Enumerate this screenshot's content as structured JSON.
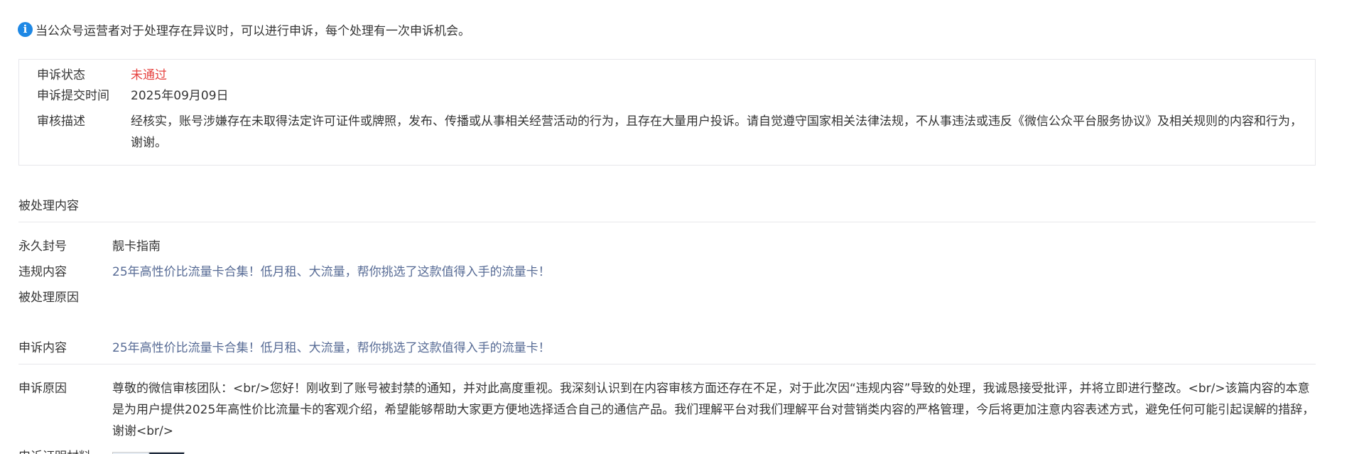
{
  "notice": {
    "icon": "info-icon",
    "text": "当公众号运营者对于处理存在异议时，可以进行申诉，每个处理有一次申诉机会。"
  },
  "status": {
    "state_label": "申诉状态",
    "state_value": "未通过",
    "state_color": "#e64340",
    "submit_label": "申诉提交时间",
    "submit_value": "2025年09月09日",
    "desc_label": "审核描述",
    "desc_value": "经核实，账号涉嫌存在未取得法定许可证件或牌照，发布、传播或从事相关经营活动的行为，且存在大量用户投诉。请自觉遵守国家相关法律法规，不从事违法或违反《微信公众平台服务协议》及相关规则的内容和行为，谢谢。"
  },
  "processed": {
    "section_title": "被处理内容",
    "ban_label": "永久封号",
    "ban_value": "靓卡指南",
    "violation_label": "违规内容",
    "violation_value": "25年高性价比流量卡合集！低月租、大流量，帮你挑选了这款值得入手的流量卡！",
    "reason_label": "被处理原因",
    "reason_value": ""
  },
  "appeal": {
    "content_label": "申诉内容",
    "content_value": "25年高性价比流量卡合集！低月租、大流量，帮你挑选了这款值得入手的流量卡！",
    "reason_label": "申诉原因",
    "reason_value": "尊敬的微信审核团队：<br/>您好！刚收到了账号被封禁的通知，并对此高度重视。我深刻认识到在内容审核方面还存在不足，对于此次因“违规内容”导致的处理，我诚恳接受批评，并将立即进行整改。<br/>该篇内容的本意是为用户提供2025年高性价比流量卡的客观介绍，希望能够帮助大家更方便地选择适合自己的通信产品。我们理解平台对我们理解平台对营销类内容的严格管理，今后将更加注意内容表述方式，避免任何可能引起误解的措辞，谢谢<br/>",
    "evidence_label": "申诉证明材料"
  },
  "colors": {
    "link": "#576b95",
    "text": "#353535",
    "border": "#e7e7eb",
    "info": "#1e88e5"
  }
}
